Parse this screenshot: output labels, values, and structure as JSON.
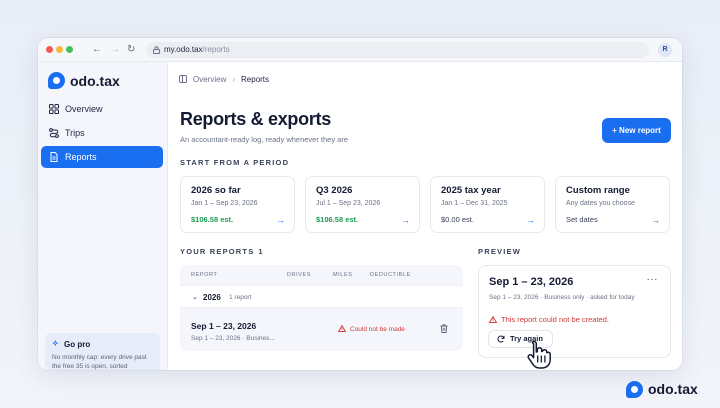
{
  "browser": {
    "url_host": "my.odo.tax",
    "url_path": "/reports",
    "avatar_initial": "R"
  },
  "sidebar": {
    "brand": "odo.tax",
    "items": [
      {
        "label": "Overview",
        "icon": "grid-icon",
        "active": false
      },
      {
        "label": "Trips",
        "icon": "route-icon",
        "active": false
      },
      {
        "label": "Reports",
        "icon": "document-icon",
        "active": true
      }
    ],
    "promo": {
      "title": "Go pro",
      "text": "No monthly cap: every drive past the free 35 is open, sorted"
    }
  },
  "header": {
    "breadcrumb": [
      "Overview",
      "Reports"
    ],
    "title": "Reports & exports",
    "subtitle": "An accountant-ready log, ready whenever they are",
    "new_report_label": "New report"
  },
  "periods": {
    "label": "START FROM A PERIOD",
    "cards": [
      {
        "title": "2026 so far",
        "range": "Jan 1 – Sep 23, 2026",
        "value": "$106.58 est."
      },
      {
        "title": "Q3 2026",
        "range": "Jul 1 – Sep 23, 2026",
        "value": "$106.58 est."
      },
      {
        "title": "2025 tax year",
        "range": "Jan 1 – Dec 31, 2025",
        "value": "$0.00 est."
      },
      {
        "title": "Custom range",
        "range": "Any dates you choose",
        "value": "Set dates"
      }
    ]
  },
  "reports": {
    "label": "YOUR REPORTS",
    "count": "1",
    "columns": [
      "REPORT",
      "DRIVES",
      "MILES",
      "DEDUCTIBLE"
    ],
    "group": {
      "year": "2026",
      "count": "1 report"
    },
    "rows": [
      {
        "title": "Sep 1 – 23, 2026",
        "sub": "Sep 1 – 23, 2026 · Busines...",
        "status": "Could not be made"
      }
    ]
  },
  "preview": {
    "label": "PREVIEW",
    "title": "Sep 1 – 23, 2026",
    "sub": "Sep 1 – 23, 2026 · Business only · asked for today",
    "error": "This report could not be created.",
    "retry_label": "Try again"
  },
  "footer_brand": "odo.tax",
  "colors": {
    "accent": "#1a6ff0",
    "positive": "#1f9d55",
    "error": "#d03a3a"
  }
}
